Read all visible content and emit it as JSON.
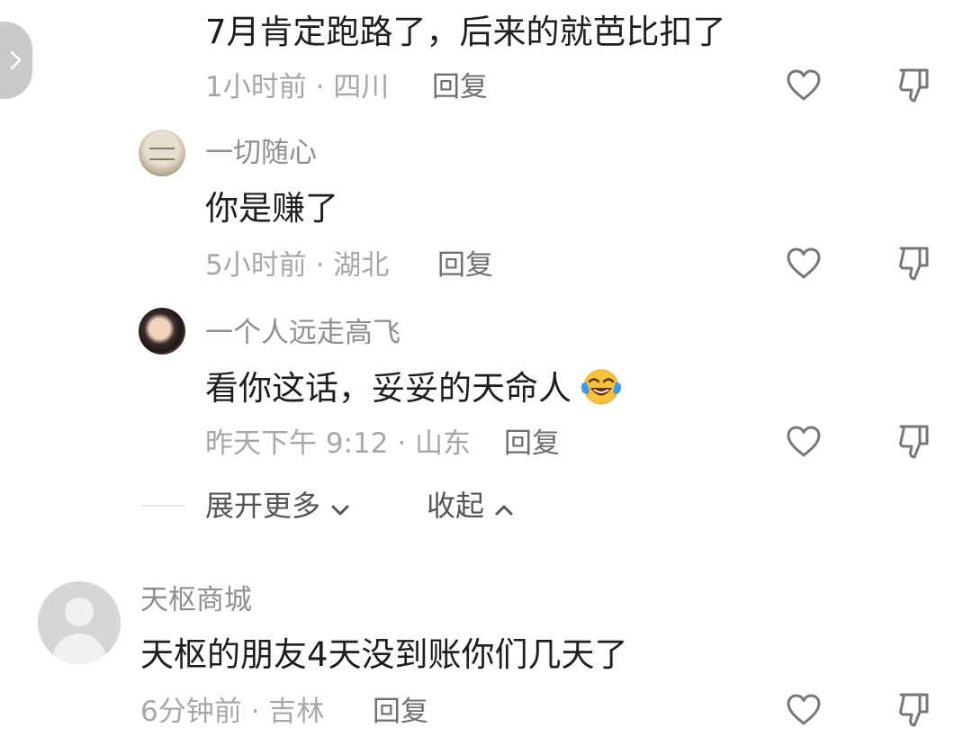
{
  "comments": [
    {
      "text": "7月肯定跑路了，后来的就芭比扣了",
      "meta": "1小时前 · 四川",
      "reply_label": "回复"
    },
    {
      "username": "一切随心",
      "text": "你是赚了",
      "meta": "5小时前 · 湖北",
      "reply_label": "回复"
    },
    {
      "username": "一个人远走高飞",
      "text": "看你这话，妥妥的天命人",
      "meta": "昨天下午 9:12 · 山东",
      "reply_label": "回复"
    },
    {
      "username": "天枢商城",
      "text": "天枢的朋友4天没到账你们几天了",
      "meta": "6分钟前 · 吉林",
      "reply_label": "回复"
    }
  ],
  "thread_controls": {
    "expand_more": "展开更多",
    "collapse": "收起"
  },
  "icons": {
    "like": "heart-icon",
    "dislike": "thumbs-down-icon",
    "emoji": "laughing-crying-emoji",
    "nav": "chevron-right-icon"
  },
  "colors": {
    "primary_text": "#1e1e1e",
    "secondary_text": "#a7a7a7",
    "username_text": "#8f8f8f",
    "icon_gray": "#777777",
    "emoji_yellow": "#f6c13c",
    "tear_blue": "#3d9bef"
  }
}
